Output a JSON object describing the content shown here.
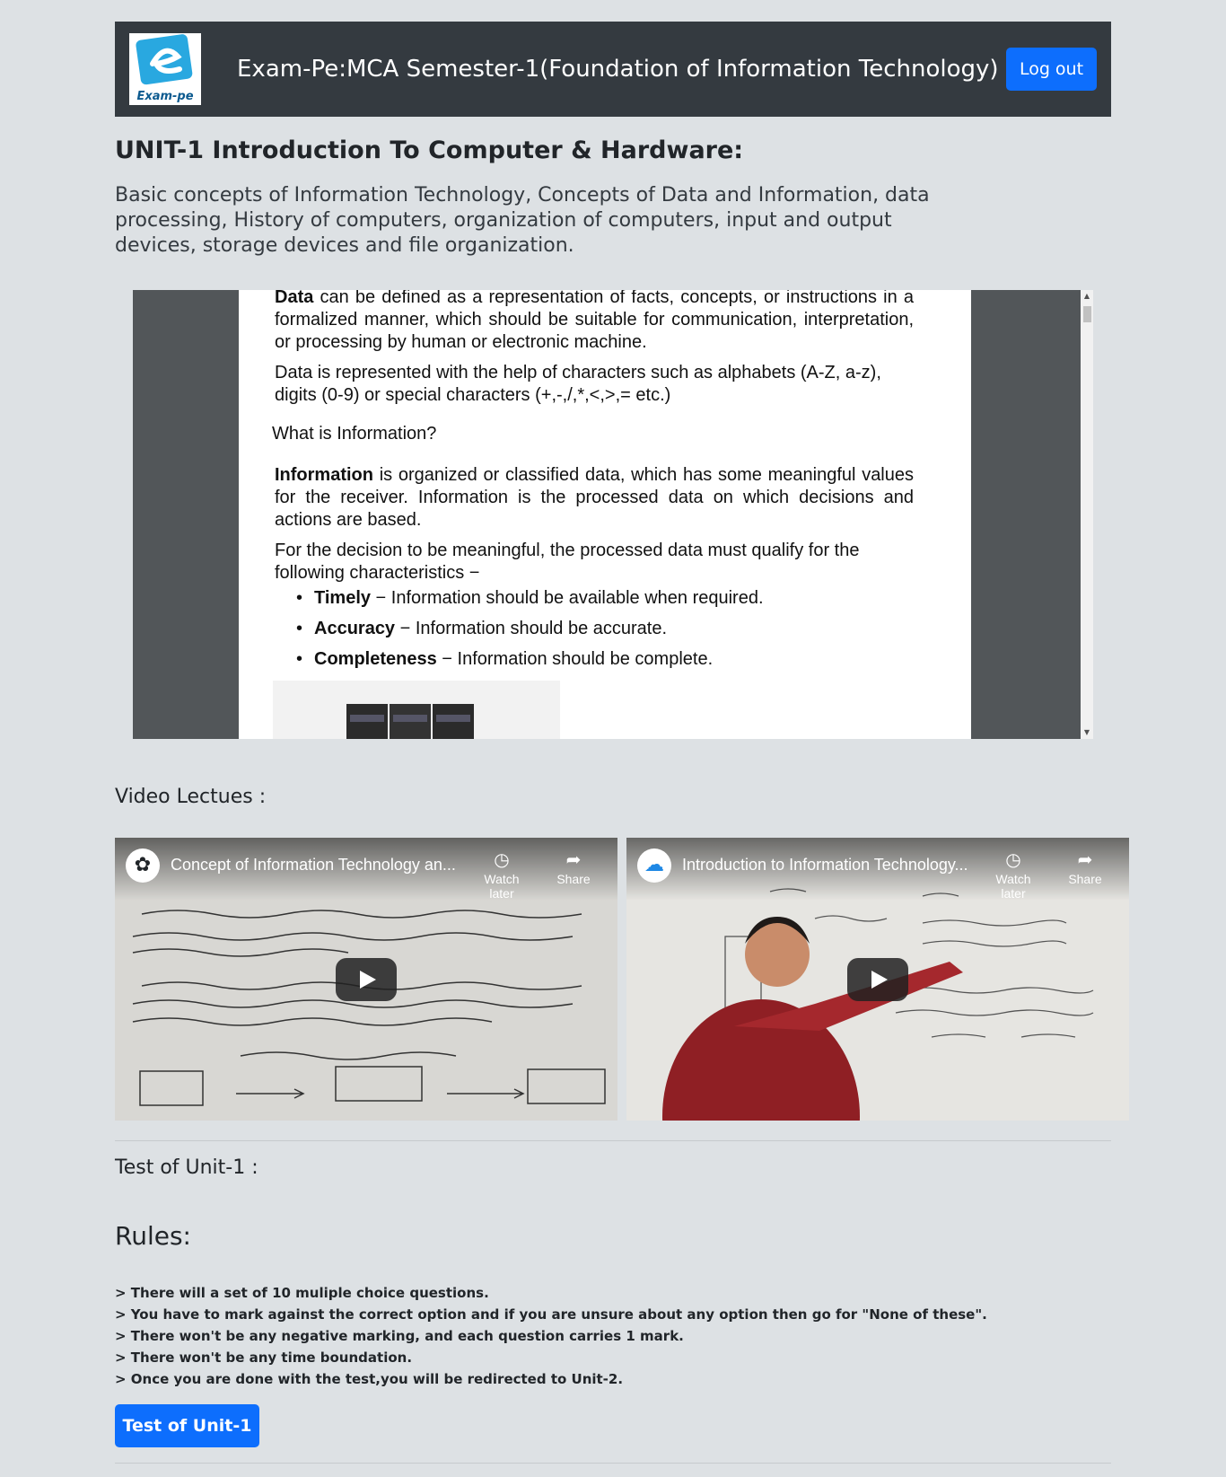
{
  "header": {
    "logo_text": "Exam-pe",
    "title": "Exam-Pe:MCA Semester-1(Foundation of Information Technology)",
    "logout_label": "Log out"
  },
  "unit": {
    "title": "UNIT-1 Introduction To Computer & Hardware:",
    "description": "Basic concepts of Information Technology, Concepts of Data and Information, data processing, History of computers, organization of computers, input and output devices, storage devices and file organization."
  },
  "pdf": {
    "p1_bold": "Data",
    "p1_rest": " can be defined as a representation of facts, concepts, or instructions in a formalized manner, which should be suitable for communication, interpretation, or processing by human or electronic machine.",
    "p2": "Data is represented with the help of characters such as alphabets (A-Z, a-z), digits (0-9) or special characters (+,-,/,*,<,>,= etc.)",
    "heading": "What is Information?",
    "p3_bold": "Information",
    "p3_rest": " is organized or classified data, which has some meaningful values for the receiver. Information is the processed data on which decisions and actions are based.",
    "p4": "For the decision to be meaningful, the processed data must qualify for the following characteristics −",
    "bullets": [
      {
        "bold": "Timely",
        "rest": " − Information should be available when required."
      },
      {
        "bold": "Accuracy",
        "rest": " − Information should be accurate."
      },
      {
        "bold": "Completeness",
        "rest": " − Information should be complete."
      }
    ],
    "bullet_char": "•"
  },
  "video_section_label": "Video Lectues :",
  "videos": [
    {
      "title": "Concept of Information Technology an...",
      "watch_later": "Watch later",
      "share": "Share",
      "channel_icon": "flower-icon",
      "bg": "#d9d8d4"
    },
    {
      "title": "Introduction to Information Technology...",
      "watch_later": "Watch later",
      "share": "Share",
      "channel_icon": "cloud-play-icon",
      "bg": "#e4e3df"
    }
  ],
  "test_section_label": "Test of Unit-1 :",
  "rules": {
    "title": "Rules:",
    "items": [
      "> There will a set of 10 muliple choice questions.",
      "> You have to mark against the correct option and if you are unsure about any option then go for \"None of these\".",
      "> There won't be any negative marking, and each question carries 1 mark.",
      "> There won't be any time boundation.",
      "> Once you are done with the test,you will be redirected to Unit-2."
    ]
  },
  "test_button_label": "Test of Unit-1",
  "colors": {
    "page_bg": "#dde1e4",
    "header_bg": "#343a40",
    "primary": "#0d6efd",
    "pdf_bg": "#525659"
  }
}
